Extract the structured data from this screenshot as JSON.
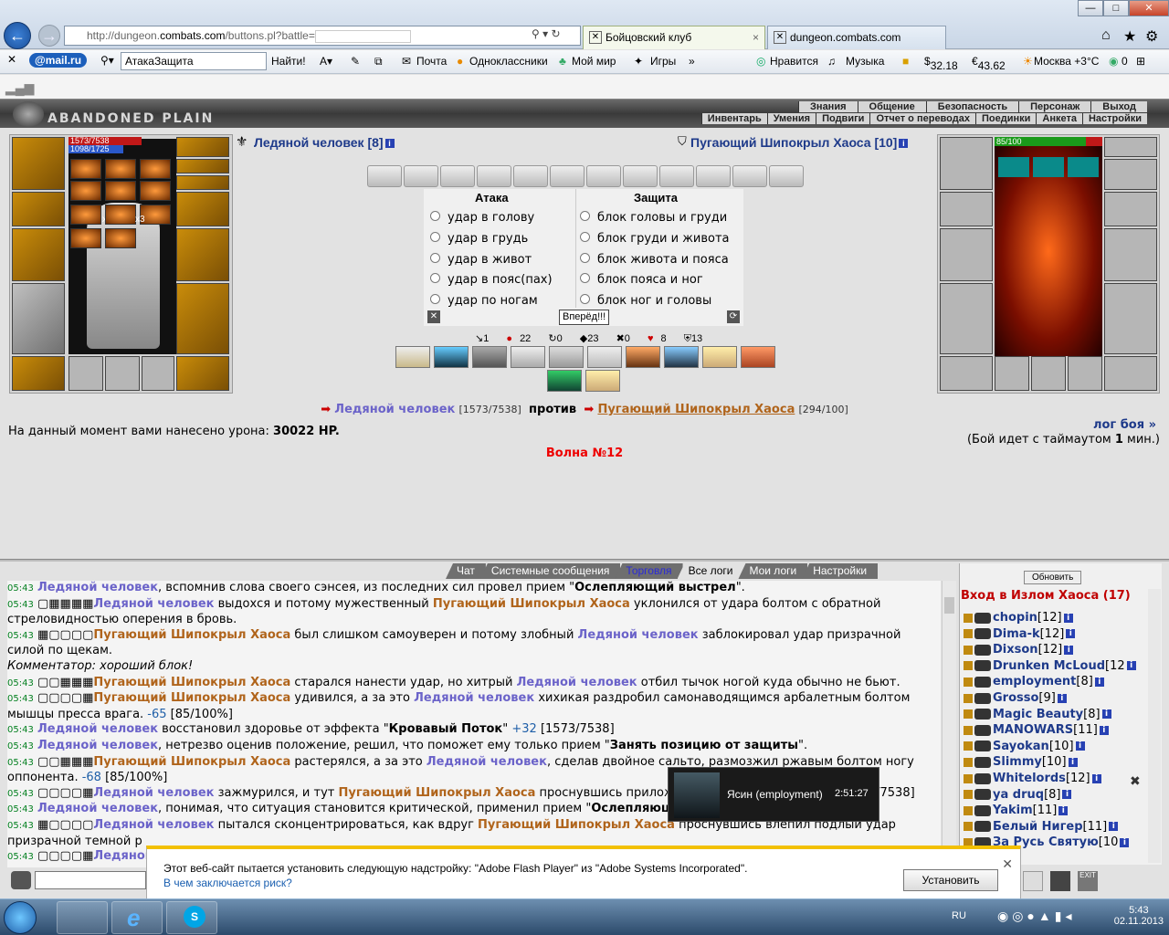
{
  "browser": {
    "address_prefix": "http://dungeon.",
    "address_domain": "combats.com",
    "address_suffix": "/buttons.pl?battle=",
    "tabs": [
      {
        "label": "Бойцовский клуб"
      },
      {
        "label": "dungeon.combats.com"
      }
    ]
  },
  "toolbar": {
    "mail_brand": "@mail.ru",
    "search_select": "АтакаЗащита",
    "find_btn": "Найти!",
    "mail_link": "Почта",
    "ok_link": "Одноклассники",
    "myworld_link": "Мой мир",
    "games_link": "Игры",
    "like_link": "Нравится",
    "music_link": "Музыка",
    "usd": "32.18",
    "eur": "43.62",
    "weather": "Москва +3°C",
    "counter": "0"
  },
  "game": {
    "logo": "ABANDONED PLAIN",
    "menu_top": [
      "Знания",
      "Общение",
      "Безопасность",
      "Персонаж",
      "Выход"
    ],
    "menu_bottom": [
      "Инвентарь",
      "Умения",
      "Подвиги",
      "Отчет о переводах",
      "Поединки",
      "Анкета",
      "Настройки"
    ],
    "player": {
      "name": "Ледяной человек [8]",
      "hp": "1573/7538",
      "mana": "1098/1725"
    },
    "enemy": {
      "name": "Пугающий Шипокрыл Хаоса [10]",
      "hp": "85/100"
    },
    "bag_counts": [
      "x3",
      "x3"
    ],
    "attack_header": "Атака",
    "defense_header": "Защита",
    "attack_opts": [
      "удар в голову",
      "удар в грудь",
      "удар в живот",
      "удар в пояс(пах)",
      "удар по ногам"
    ],
    "defense_opts": [
      "блок головы и груди",
      "блок груди и живота",
      "блок живота и пояса",
      "блок пояса и ног",
      "блок ног и головы"
    ],
    "go_button": "Вперёд!!!",
    "stats": [
      "1",
      "22",
      "0",
      "23",
      "0",
      "8",
      "13"
    ],
    "versus": {
      "p1": "Ледяной человек",
      "p1_hp": "[1573/7538]",
      "vs": "против",
      "p2": "Пугающий Шипокрыл Хаоса",
      "p2_hp": "[294/100]"
    },
    "damage_text": "На данный момент вами нанесено урона:",
    "damage_value": "30022 HP.",
    "logs_link": "лог боя »",
    "timeout_a": "(Бой идет с таймаутом ",
    "timeout_b": "1",
    "timeout_c": " мин.)",
    "wave": "Волна №12"
  },
  "chat": {
    "tabs": [
      "Чат",
      "Системные сообщения",
      "Торговля",
      "Все логи",
      "Мои логи",
      "Настройки"
    ],
    "lines": [
      {
        "t": "05:43",
        "html": "<span class='p1'>Ледяной человек</span>, вспомнив слова своего сэнсея, из последних сил провел прием \"<b>Ослепляющий выстрел</b>\"."
      },
      {
        "t": "05:43",
        "html": "▢▦▦▦▦<span class='p1'>Ледяной человек</span> выдохся и потому мужественный <span class='p2'>Пугающий Шипокрыл Хаоса</span> уклонился от удара болтом с обратной стреловидностью оперения в бровь."
      },
      {
        "t": "05:43",
        "html": "▦▢▢▢▢<span class='p2'>Пугающий Шипокрыл Хаоса</span> был слишком самоуверен и потому злобный <span class='p1'>Ледяной человек</span> заблокировал удар призрачной силой по щекам."
      },
      {
        "t": "",
        "html": "<i>Комментатор: хороший блок!</i>"
      },
      {
        "t": "05:43",
        "html": "▢▢▦▦▦<span class='p2'>Пугающий Шипокрыл Хаоса</span> старался нанести удар, но хитрый <span class='p1'>Ледяной человек</span> отбил тычок ногой куда обычно не бьют."
      },
      {
        "t": "05:43",
        "html": "▢▢▢▢▦<span class='p2'>Пугающий Шипокрыл Хаоса</span> удивился, а за это <span class='p1'>Ледяной человек</span> хихикая раздробил самонаводящимся арбалетным болтом мышцы пресса врага. <span class='num'>-65</span> [85/100%]"
      },
      {
        "t": "05:43",
        "html": "<span class='p1'>Ледяной человек</span> восстановил здоровье от эффекта \"<b>Кровавый Поток</b>\" <span class='num'>+32</span> [1573/7538]"
      },
      {
        "t": "05:43",
        "html": "<span class='p1'>Ледяной человек</span>, нетрезво оценив положение, решил, что поможет ему только прием \"<b>Занять позицию от защиты</b>\"."
      },
      {
        "t": "05:43",
        "html": "▢▢▦▦▦<span class='p2'>Пугающий Шипокрыл Хаоса</span> растерялся, а за это <span class='p1'>Ледяной человек</span>, сделав двойное сальто, размозжил ржавым болтом ногу оппонента. <span class='num'>-68</span> [85/100%]"
      },
      {
        "t": "05:43",
        "html": "▢▢▢▢▦<span class='p1'>Ледяной человек</span> зажмурился, и тут <span class='p2'>Пугающий Шипокрыл Хаоса</span> проснувшись прилож                                                  вой ноге соперника. <span class='num'>-218</span> [1541/7538]"
      },
      {
        "t": "05:43",
        "html": "<span class='p1'>Ледяной человек</span>, понимая, что ситуация становится критической, применил прием \"<b>Ослепляющий выс</b>"
      },
      {
        "t": "05:43",
        "html": "▦▢▢▢▢<span class='p1'>Ледяной человек</span> пытался сконцентрироваться, как вдруг <span class='p2'>Пугающий Шипокрыл Хаоса</span> проснувшись влепил подлый удар призрачной темной р"
      },
      {
        "t": "05:43",
        "html": "▢▢▢▢▦<span class='p1'>Ледяной</span>"
      }
    ]
  },
  "side": {
    "refresh_btn": "Обновить",
    "room": "Вход в Излом Хаоса (17)",
    "users": [
      {
        "name": "chopin",
        "lvl": "[12]"
      },
      {
        "name": "Dima-k",
        "lvl": "[12]"
      },
      {
        "name": "Dixson",
        "lvl": "[12]"
      },
      {
        "name": "Drunken McLoud",
        "lvl": "[12"
      },
      {
        "name": "employment",
        "lvl": "[8]"
      },
      {
        "name": "Grosso",
        "lvl": "[9]"
      },
      {
        "name": "Magic Beauty",
        "lvl": "[8]"
      },
      {
        "name": "MANOWARS",
        "lvl": "[11]"
      },
      {
        "name": "Sayokan",
        "lvl": "[10]"
      },
      {
        "name": "Slimmy",
        "lvl": "[10]"
      },
      {
        "name": "Whitelords",
        "lvl": "[12]"
      },
      {
        "name": "ya druq",
        "lvl": "[8]"
      },
      {
        "name": "Yakim",
        "lvl": "[11]"
      },
      {
        "name": "Белый Нигер",
        "lvl": "[11]"
      },
      {
        "name": "За Русь Святую",
        "lvl": "[10"
      }
    ]
  },
  "video": {
    "caller": "Ясин (employment)",
    "time": "2:51:27"
  },
  "notification": {
    "text": "Этот веб-сайт пытается установить следующую надстройку: \"Adobe Flash Player\" из \"Adobe Systems Incorporated\".",
    "link": "В чем заключается риск?",
    "install": "Установить"
  },
  "taskbar": {
    "lang": "RU",
    "time": "5:43",
    "date": "02.11.2013"
  }
}
